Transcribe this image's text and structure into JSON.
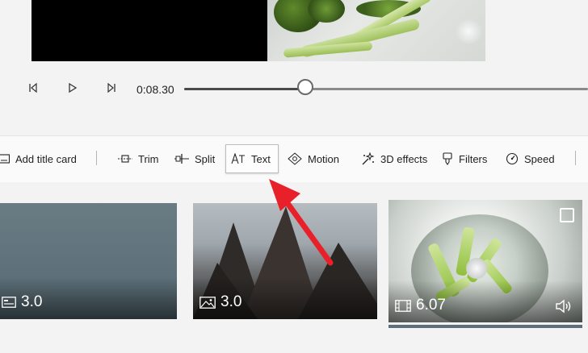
{
  "player": {
    "time": "0:08.30",
    "progress": 0.3
  },
  "toolbar": {
    "add_title_card": "Add title card",
    "trim": "Trim",
    "split": "Split",
    "text": "Text",
    "motion": "Motion",
    "effects_3d": "3D effects",
    "filters": "Filters",
    "speed": "Speed"
  },
  "storyboard": {
    "cards": [
      {
        "duration": "3.0",
        "kind": "title-card-icon"
      },
      {
        "duration": "3.0",
        "kind": "image-icon"
      },
      {
        "duration": "6.07",
        "kind": "video-icon"
      }
    ]
  },
  "colors": {
    "annotation_arrow": "#e8202a",
    "track": "#8a8a8a"
  }
}
